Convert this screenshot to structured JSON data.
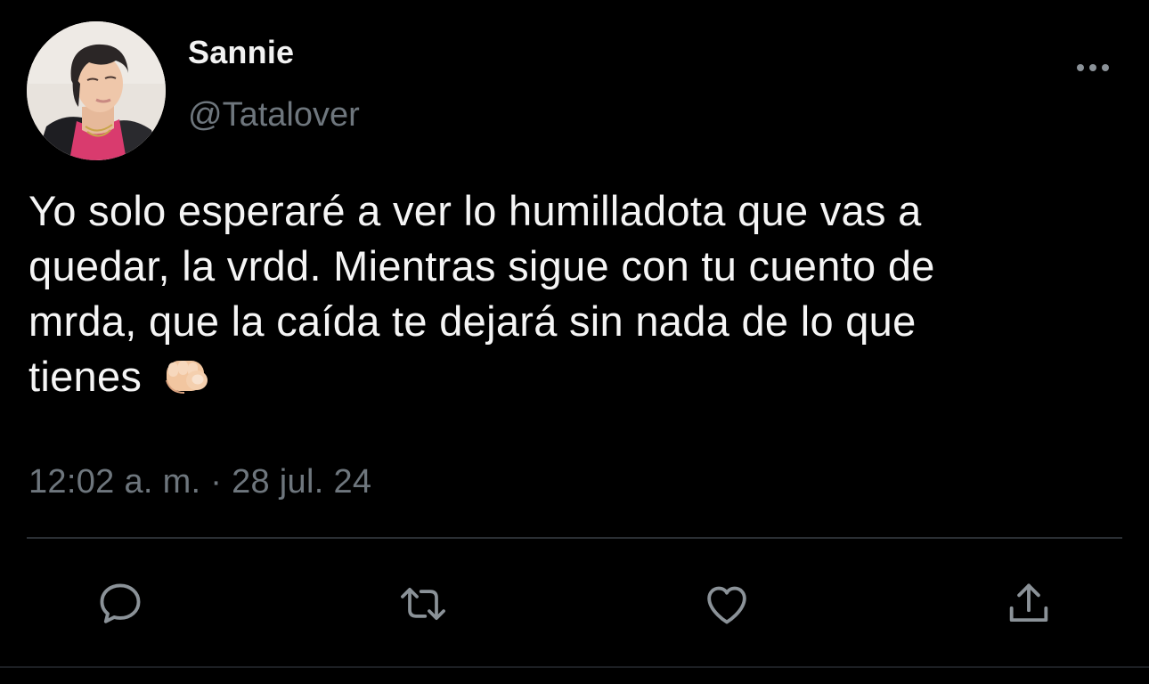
{
  "user": {
    "display_name": "Sannie",
    "handle": "@Tatalover"
  },
  "tweet": {
    "lines": [
      "Yo solo esperaré a ver lo humilladota que vas a",
      "quedar, la vrdd. Mientras sigue con tu cuento de",
      "mrda, que la caída te dejará sin nada de lo que",
      "tienes"
    ],
    "emoji": "backhand-index-pointing-at-viewer",
    "timestamp": "12:02 a. m. · 28 jul. 24"
  },
  "actions": {
    "reply_icon": "reply-icon",
    "retweet_icon": "retweet-icon",
    "like_icon": "like-icon",
    "share_icon": "share-icon",
    "more_icon": "more-icon"
  },
  "colors": {
    "background": "#000000",
    "text": "#f5f5f5",
    "secondary": "#6e767d",
    "divider": "#2a2e33"
  }
}
